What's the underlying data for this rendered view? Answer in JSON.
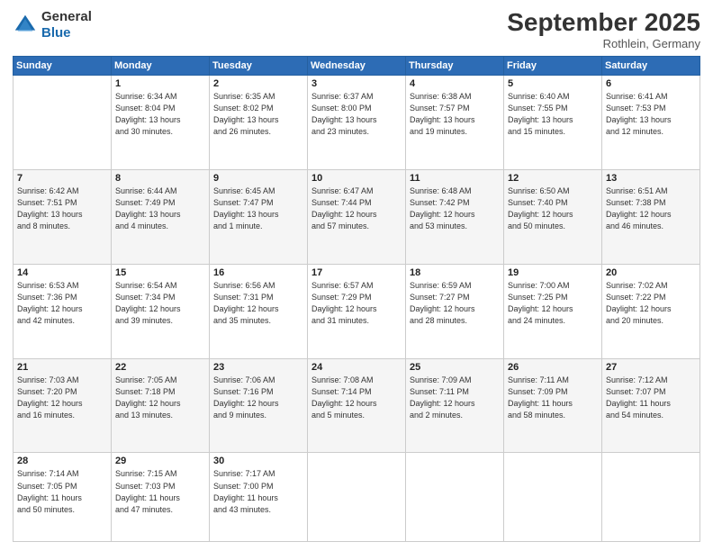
{
  "header": {
    "logo_line1": "General",
    "logo_line2": "Blue",
    "month": "September 2025",
    "location": "Rothlein, Germany"
  },
  "weekdays": [
    "Sunday",
    "Monday",
    "Tuesday",
    "Wednesday",
    "Thursday",
    "Friday",
    "Saturday"
  ],
  "weeks": [
    [
      {
        "day": "",
        "info": ""
      },
      {
        "day": "1",
        "info": "Sunrise: 6:34 AM\nSunset: 8:04 PM\nDaylight: 13 hours\nand 30 minutes."
      },
      {
        "day": "2",
        "info": "Sunrise: 6:35 AM\nSunset: 8:02 PM\nDaylight: 13 hours\nand 26 minutes."
      },
      {
        "day": "3",
        "info": "Sunrise: 6:37 AM\nSunset: 8:00 PM\nDaylight: 13 hours\nand 23 minutes."
      },
      {
        "day": "4",
        "info": "Sunrise: 6:38 AM\nSunset: 7:57 PM\nDaylight: 13 hours\nand 19 minutes."
      },
      {
        "day": "5",
        "info": "Sunrise: 6:40 AM\nSunset: 7:55 PM\nDaylight: 13 hours\nand 15 minutes."
      },
      {
        "day": "6",
        "info": "Sunrise: 6:41 AM\nSunset: 7:53 PM\nDaylight: 13 hours\nand 12 minutes."
      }
    ],
    [
      {
        "day": "7",
        "info": "Sunrise: 6:42 AM\nSunset: 7:51 PM\nDaylight: 13 hours\nand 8 minutes."
      },
      {
        "day": "8",
        "info": "Sunrise: 6:44 AM\nSunset: 7:49 PM\nDaylight: 13 hours\nand 4 minutes."
      },
      {
        "day": "9",
        "info": "Sunrise: 6:45 AM\nSunset: 7:47 PM\nDaylight: 13 hours\nand 1 minute."
      },
      {
        "day": "10",
        "info": "Sunrise: 6:47 AM\nSunset: 7:44 PM\nDaylight: 12 hours\nand 57 minutes."
      },
      {
        "day": "11",
        "info": "Sunrise: 6:48 AM\nSunset: 7:42 PM\nDaylight: 12 hours\nand 53 minutes."
      },
      {
        "day": "12",
        "info": "Sunrise: 6:50 AM\nSunset: 7:40 PM\nDaylight: 12 hours\nand 50 minutes."
      },
      {
        "day": "13",
        "info": "Sunrise: 6:51 AM\nSunset: 7:38 PM\nDaylight: 12 hours\nand 46 minutes."
      }
    ],
    [
      {
        "day": "14",
        "info": "Sunrise: 6:53 AM\nSunset: 7:36 PM\nDaylight: 12 hours\nand 42 minutes."
      },
      {
        "day": "15",
        "info": "Sunrise: 6:54 AM\nSunset: 7:34 PM\nDaylight: 12 hours\nand 39 minutes."
      },
      {
        "day": "16",
        "info": "Sunrise: 6:56 AM\nSunset: 7:31 PM\nDaylight: 12 hours\nand 35 minutes."
      },
      {
        "day": "17",
        "info": "Sunrise: 6:57 AM\nSunset: 7:29 PM\nDaylight: 12 hours\nand 31 minutes."
      },
      {
        "day": "18",
        "info": "Sunrise: 6:59 AM\nSunset: 7:27 PM\nDaylight: 12 hours\nand 28 minutes."
      },
      {
        "day": "19",
        "info": "Sunrise: 7:00 AM\nSunset: 7:25 PM\nDaylight: 12 hours\nand 24 minutes."
      },
      {
        "day": "20",
        "info": "Sunrise: 7:02 AM\nSunset: 7:22 PM\nDaylight: 12 hours\nand 20 minutes."
      }
    ],
    [
      {
        "day": "21",
        "info": "Sunrise: 7:03 AM\nSunset: 7:20 PM\nDaylight: 12 hours\nand 16 minutes."
      },
      {
        "day": "22",
        "info": "Sunrise: 7:05 AM\nSunset: 7:18 PM\nDaylight: 12 hours\nand 13 minutes."
      },
      {
        "day": "23",
        "info": "Sunrise: 7:06 AM\nSunset: 7:16 PM\nDaylight: 12 hours\nand 9 minutes."
      },
      {
        "day": "24",
        "info": "Sunrise: 7:08 AM\nSunset: 7:14 PM\nDaylight: 12 hours\nand 5 minutes."
      },
      {
        "day": "25",
        "info": "Sunrise: 7:09 AM\nSunset: 7:11 PM\nDaylight: 12 hours\nand 2 minutes."
      },
      {
        "day": "26",
        "info": "Sunrise: 7:11 AM\nSunset: 7:09 PM\nDaylight: 11 hours\nand 58 minutes."
      },
      {
        "day": "27",
        "info": "Sunrise: 7:12 AM\nSunset: 7:07 PM\nDaylight: 11 hours\nand 54 minutes."
      }
    ],
    [
      {
        "day": "28",
        "info": "Sunrise: 7:14 AM\nSunset: 7:05 PM\nDaylight: 11 hours\nand 50 minutes."
      },
      {
        "day": "29",
        "info": "Sunrise: 7:15 AM\nSunset: 7:03 PM\nDaylight: 11 hours\nand 47 minutes."
      },
      {
        "day": "30",
        "info": "Sunrise: 7:17 AM\nSunset: 7:00 PM\nDaylight: 11 hours\nand 43 minutes."
      },
      {
        "day": "",
        "info": ""
      },
      {
        "day": "",
        "info": ""
      },
      {
        "day": "",
        "info": ""
      },
      {
        "day": "",
        "info": ""
      }
    ]
  ]
}
